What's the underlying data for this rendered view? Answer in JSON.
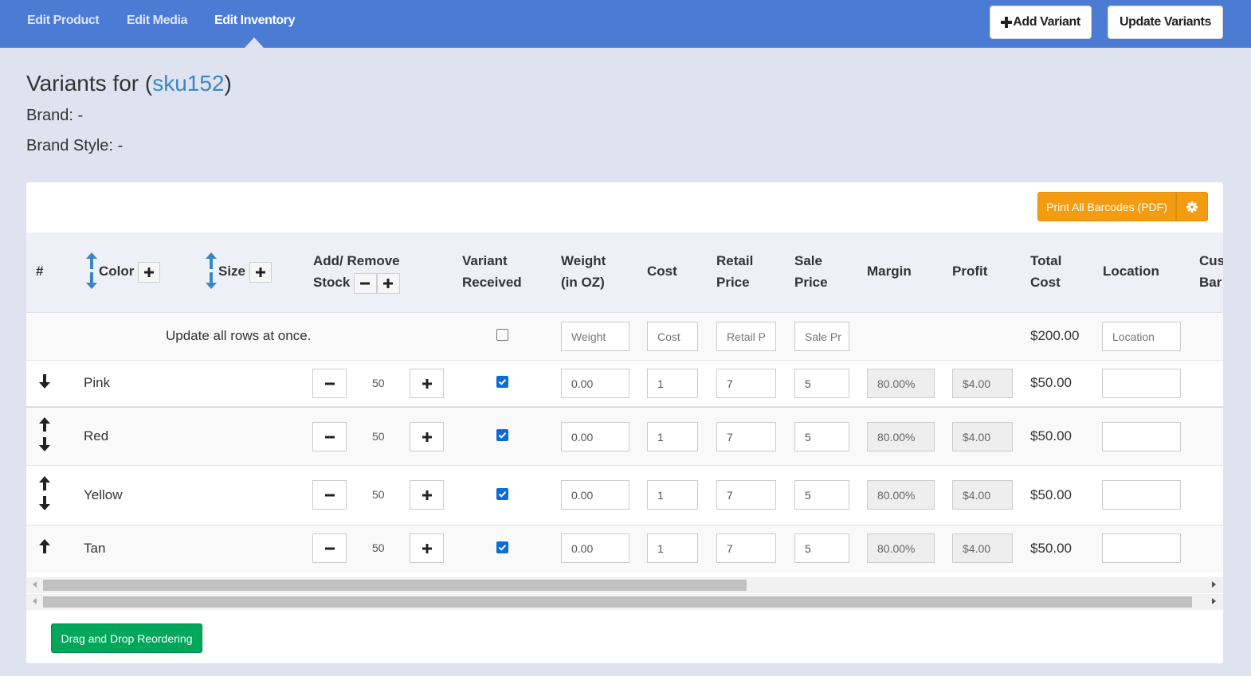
{
  "nav": {
    "tabs": [
      {
        "label": "Edit Product"
      },
      {
        "label": "Edit Media"
      },
      {
        "label": "Edit Inventory"
      }
    ],
    "add_variant_label": "Add Variant",
    "update_variants_label": "Update Variants"
  },
  "header": {
    "title_prefix": "Variants for (",
    "sku": "sku152",
    "title_suffix": ")",
    "brand": "Brand: -",
    "brand_style": "Brand Style: -"
  },
  "toolbar": {
    "print_label": "Print All Barcodes (PDF)"
  },
  "columns": {
    "num": "#",
    "color": "Color",
    "size": "Size",
    "stock_1": "Add/ Remove",
    "stock_2": "Stock",
    "received_1": "Variant",
    "received_2": "Received",
    "weight_1": "Weight",
    "weight_2": "(in OZ)",
    "cost": "Cost",
    "retail_1": "Retail",
    "retail_2": "Price",
    "sale_1": "Sale",
    "sale_2": "Price",
    "margin": "Margin",
    "profit": "Profit",
    "total_1": "Total",
    "total_2": "Cost",
    "location": "Location",
    "custom_1": "Cus",
    "custom_2": "Bar"
  },
  "bulk": {
    "label": "Update all rows at once.",
    "weight_placeholder": "Weight",
    "cost_placeholder": "Cost",
    "retail_placeholder": "Retail P",
    "sale_placeholder": "Sale Pr",
    "total": "$200.00",
    "location_placeholder": "Location"
  },
  "rows": [
    {
      "color": "Pink",
      "stock": "50",
      "received": true,
      "weight": "0.00",
      "cost": "1",
      "retail": "7",
      "sale": "5",
      "margin": "80.00%",
      "profit": "$4.00",
      "total": "$50.00",
      "location": ""
    },
    {
      "color": "Red",
      "stock": "50",
      "received": true,
      "weight": "0.00",
      "cost": "1",
      "retail": "7",
      "sale": "5",
      "margin": "80.00%",
      "profit": "$4.00",
      "total": "$50.00",
      "location": ""
    },
    {
      "color": "Yellow",
      "stock": "50",
      "received": true,
      "weight": "0.00",
      "cost": "1",
      "retail": "7",
      "sale": "5",
      "margin": "80.00%",
      "profit": "$4.00",
      "total": "$50.00",
      "location": ""
    },
    {
      "color": "Tan",
      "stock": "50",
      "received": true,
      "weight": "0.00",
      "cost": "1",
      "retail": "7",
      "sale": "5",
      "margin": "80.00%",
      "profit": "$4.00",
      "total": "$50.00",
      "location": ""
    }
  ],
  "footer": {
    "dnd_label": "Drag and Drop Reordering"
  },
  "icons": {
    "sort": "sort-arrows-icon",
    "plus": "plus-icon",
    "minus": "minus-icon",
    "gear": "gear-icon",
    "up": "arrow-up-icon",
    "down": "arrow-down-icon"
  },
  "colors": {
    "nav_bg": "#4c7bd4",
    "page_bg": "#dfe3f0",
    "print_btn": "#f39c12",
    "dnd_btn": "#00a65a",
    "sku_link": "#3b87c4",
    "checkbox": "#0b6bd8"
  }
}
